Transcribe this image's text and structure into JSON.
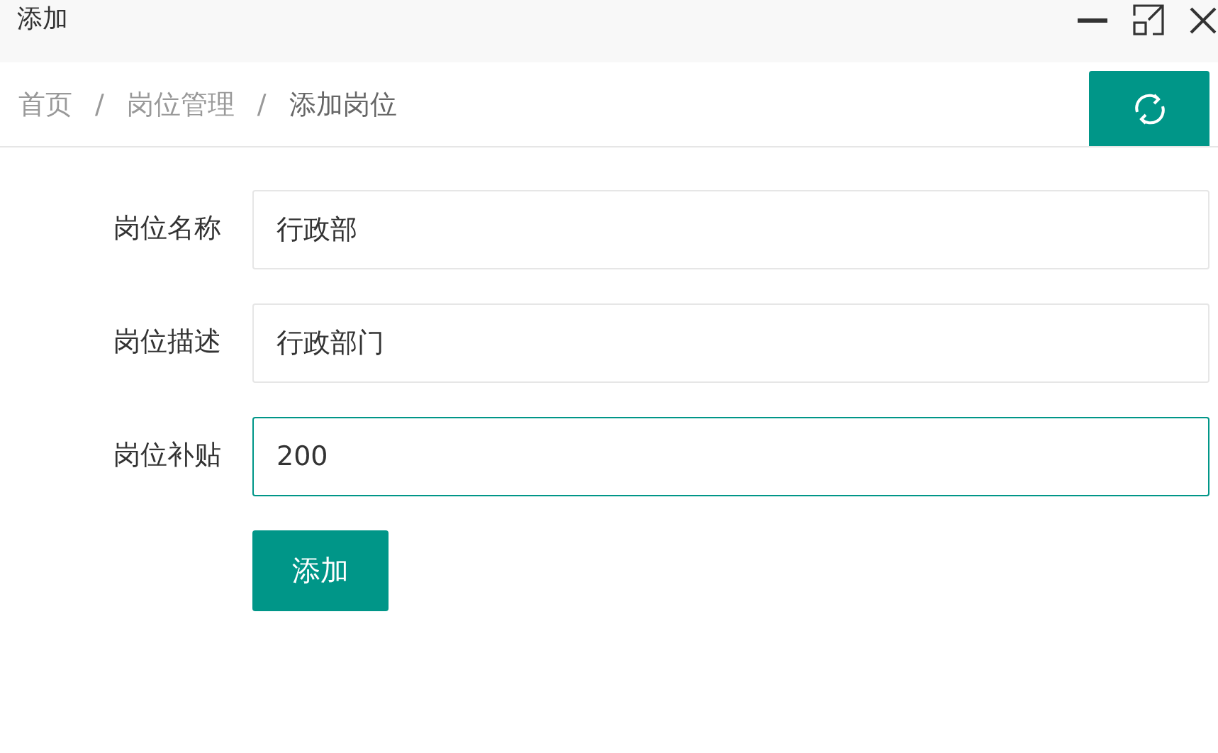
{
  "window": {
    "title": "添加"
  },
  "breadcrumb": [
    {
      "label": "首页",
      "current": false
    },
    {
      "label": "岗位管理",
      "current": false
    },
    {
      "label": "添加岗位",
      "current": true
    }
  ],
  "breadcrumb_separator": "/",
  "form": {
    "fields": [
      {
        "label": "岗位名称",
        "value": "行政部",
        "focused": false
      },
      {
        "label": "岗位描述",
        "value": "行政部门",
        "focused": false
      },
      {
        "label": "岗位补贴",
        "value": "200",
        "focused": true
      }
    ],
    "submit": "添加"
  }
}
